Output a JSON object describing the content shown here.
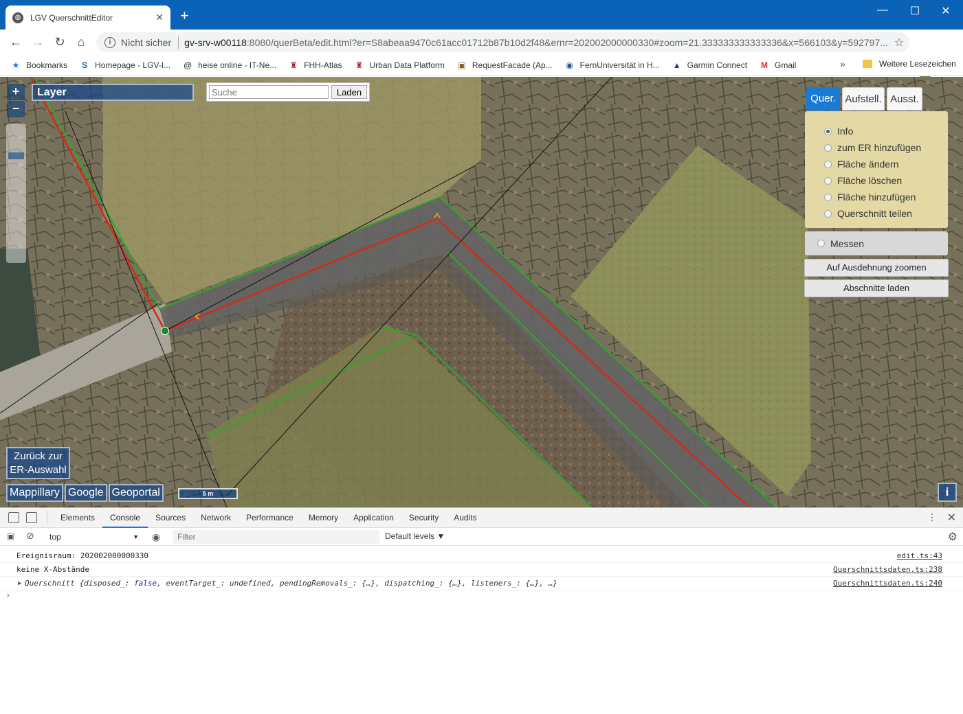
{
  "browser": {
    "tab_title": "LGV QuerschnittEditor",
    "tab_close": "✕",
    "new_tab": "+",
    "window_minimize": "—",
    "window_maximize": "☐",
    "window_close": "✕",
    "security_label": "Nicht sicher",
    "url_host": "gv-srv-w00118",
    "url_rest": ":8080/querBeta/edit.html?er=S8abeaa9470c61acc01712b87b10d2f48&ernr=202002000000330#zoom=21.333333333333336&x=566103&y=592797..."
  },
  "bookmarks": [
    {
      "label": "Bookmarks",
      "icon": "star-icon",
      "glyph": "★",
      "color": "#1a73e8"
    },
    {
      "label": "Homepage - LGV-I...",
      "icon": "sharepoint-icon",
      "glyph": "S",
      "color": "#0b6a9f"
    },
    {
      "label": "heise online - IT-Ne...",
      "icon": "heise-icon",
      "glyph": "@",
      "color": "#333333"
    },
    {
      "label": "FHH-Atlas",
      "icon": "hamburg-icon",
      "glyph": "♜",
      "color": "#c8102e"
    },
    {
      "label": "Urban Data Platform",
      "icon": "hamburg-icon",
      "glyph": "♜",
      "color": "#c8102e"
    },
    {
      "label": "RequestFacade (Ap...",
      "icon": "image-icon",
      "glyph": "▣",
      "color": "#8a5a2b"
    },
    {
      "label": "FernUniversität in H...",
      "icon": "fernuni-icon",
      "glyph": "◉",
      "color": "#1d4f91"
    },
    {
      "label": "Garmin Connect",
      "icon": "garmin-icon",
      "glyph": "▲",
      "color": "#1a3f8a"
    },
    {
      "label": "Gmail",
      "icon": "gmail-icon",
      "glyph": "M",
      "color": "#d93025"
    }
  ],
  "bookmarks_more": "»",
  "bookmarks_other": "Weitere Lesezeichen",
  "map": {
    "layer_label": "Layer",
    "search_placeholder": "Suche",
    "search_button": "Laden",
    "zoom_in": "+",
    "zoom_out": "−",
    "tabs": [
      "Quer.",
      "Aufstell.",
      "Ausst."
    ],
    "radio_options": [
      {
        "label": "Info",
        "checked": true
      },
      {
        "label": "zum ER hinzufügen",
        "checked": false
      },
      {
        "label": "Fläche ändern",
        "checked": false
      },
      {
        "label": "Fläche löschen",
        "checked": false
      },
      {
        "label": "Fläche hinzufügen",
        "checked": false
      },
      {
        "label": "Querschnitt teilen",
        "checked": false
      }
    ],
    "messen_label": "Messen",
    "zoom_extent_button": "Auf Ausdehnung zoomen",
    "load_sections_button": "Abschnitte laden",
    "back_line1": "Zurück zur",
    "back_line2": "ER-Auswahl",
    "links": [
      "Mappillary",
      "Google",
      "Geoportal"
    ],
    "scale_label": "5 m",
    "info_button": "i"
  },
  "devtools": {
    "tabs": [
      "Elements",
      "Console",
      "Sources",
      "Network",
      "Performance",
      "Memory",
      "Application",
      "Security",
      "Audits"
    ],
    "active_tab": "Console",
    "context": "top",
    "filter_placeholder": "Filter",
    "levels": "Default levels ▼",
    "logs": [
      {
        "text": "Ereignisraum: 202002000000330",
        "source": "edit.ts:43"
      },
      {
        "text": "keine X-Abstände",
        "source": "Querschnittsdaten.ts:238"
      },
      {
        "prefix": "Querschnitt ",
        "obj_open": "{disposed_: ",
        "obj_false": "false",
        "obj_rest": ", eventTarget_: undefined, pendingRemovals_: {…}, dispatching_: {…}, listeners_: {…}, …}",
        "source": "Querschnittsdaten.ts:240"
      }
    ],
    "prompt": "›"
  }
}
